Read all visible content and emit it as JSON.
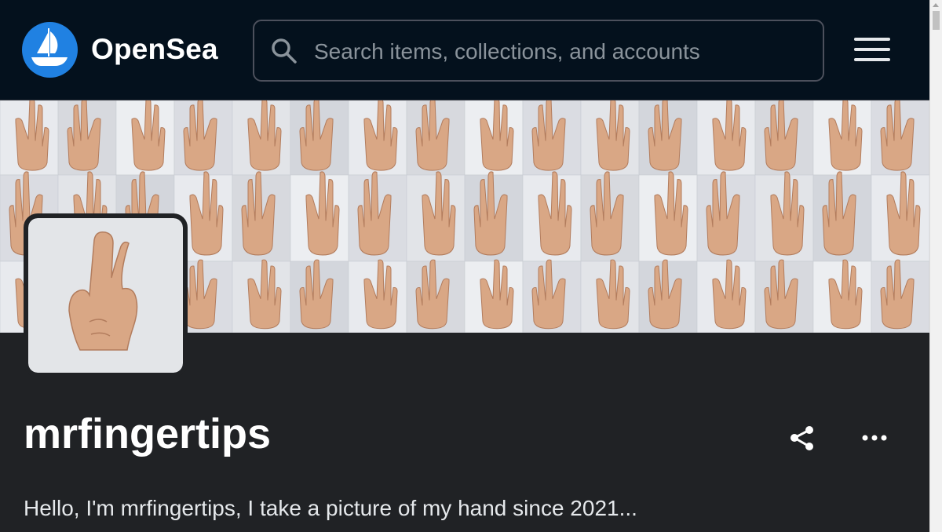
{
  "header": {
    "brand": "OpenSea",
    "logo_icon": "opensea-sailboat-icon",
    "search_placeholder": "Search items, collections, and accounts",
    "search_icon": "search-icon",
    "menu_icon": "hamburger-menu-icon"
  },
  "profile": {
    "banner": "hand-gesture-photo-collage",
    "avatar": "hand-gesture-photo",
    "username": "mrfingertips",
    "bio": "Hello, I'm mrfingertips, I take a picture of my hand since 2021...",
    "share_icon": "share-icon",
    "more_icon": "more-dots-icon"
  },
  "colors": {
    "navbar_bg": "#04111d",
    "page_bg": "#202225",
    "brand_blue": "#2081e2",
    "text": "#ffffff"
  }
}
